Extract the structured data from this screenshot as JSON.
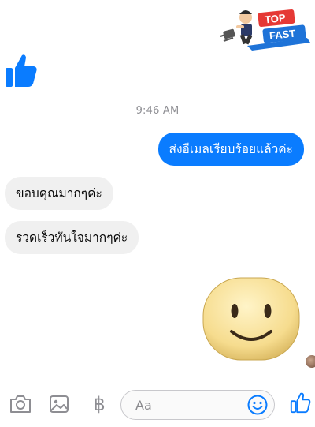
{
  "sticker_top": {
    "line1": "TOP",
    "line2": "FAST"
  },
  "timestamp": "9:46 AM",
  "messages": {
    "sent": "ส่งอีเมลเรียบร้อยแล้วค่ะ",
    "received1": "ขอบคุณมากๆค่ะ",
    "received2": "รวดเร็วทันใจมากๆค่ะ"
  },
  "composer": {
    "placeholder": "Aa",
    "currency": "฿"
  },
  "colors": {
    "accent": "#0a7cff",
    "incoming_bubble": "#f0f0f0",
    "icon_gray": "#8e8e93"
  }
}
